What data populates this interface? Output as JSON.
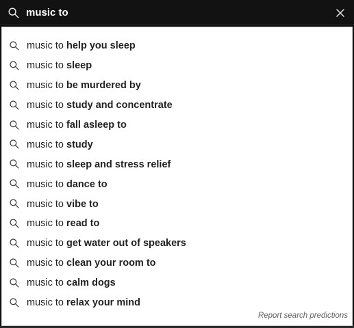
{
  "search": {
    "query": "music to",
    "placeholder": "Search"
  },
  "suggestions": [
    {
      "prefix": "music to ",
      "rest": "help you sleep"
    },
    {
      "prefix": "music to ",
      "rest": "sleep"
    },
    {
      "prefix": "music to ",
      "rest": "be murdered by"
    },
    {
      "prefix": "music to ",
      "rest": "study and concentrate"
    },
    {
      "prefix": "music to ",
      "rest": "fall asleep to"
    },
    {
      "prefix": "music to ",
      "rest": "study"
    },
    {
      "prefix": "music to ",
      "rest": "sleep and stress relief"
    },
    {
      "prefix": "music to ",
      "rest": "dance to"
    },
    {
      "prefix": "music to ",
      "rest": "vibe to"
    },
    {
      "prefix": "music to ",
      "rest": "read to"
    },
    {
      "prefix": "music to ",
      "rest": "get water out of speakers"
    },
    {
      "prefix": "music to ",
      "rest": "clean your room to"
    },
    {
      "prefix": "music to ",
      "rest": "calm dogs"
    },
    {
      "prefix": "music to ",
      "rest": "relax your mind"
    }
  ],
  "footer": {
    "report_label": "Report search predictions"
  },
  "icons": {
    "search": "search-icon",
    "clear": "close-icon"
  },
  "colors": {
    "bar_background": "#121212",
    "dropdown_background": "#ffffff",
    "text": "#222222"
  }
}
